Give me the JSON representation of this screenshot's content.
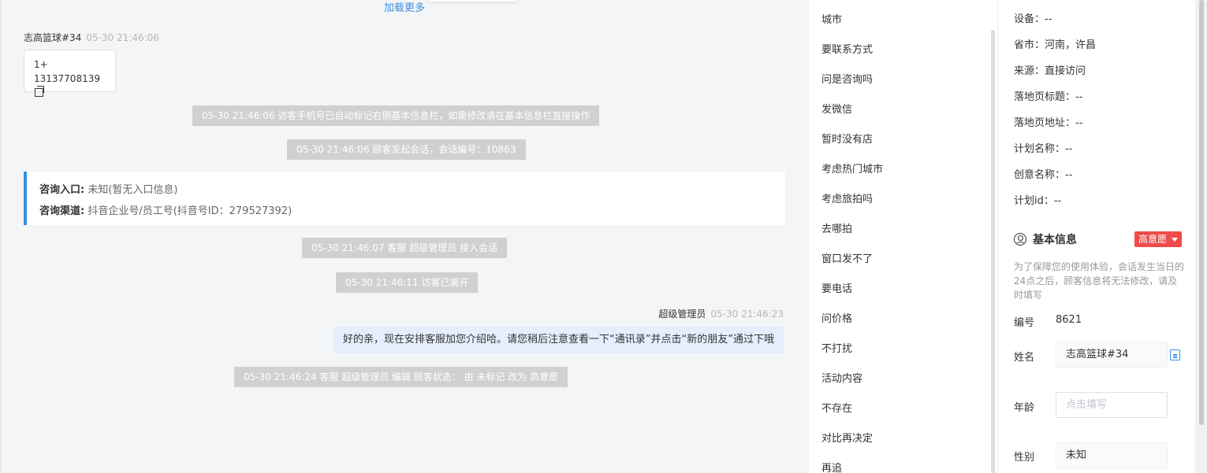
{
  "chat": {
    "load_more": "加载更多",
    "visitor": {
      "name": "志高篮球#34",
      "time": "05-30 21:46:06",
      "msg_line1": "1+",
      "msg_line2": "13137708139"
    },
    "system_messages": [
      "05-30 21:46:06 访客手机号已自动标记右侧基本信息栏，如需修改请在基本信息栏直接操作",
      "05-30 21:46:06 顾客发起会话，会话编号：10863",
      "05-30 21:46:07 客服 超级管理员 接入会话",
      "05-30 21:46:11 访客已离开",
      "05-30 21:46:24 客服 超级管理员 编辑 顾客状态： 由 未标记 改为 高意愿"
    ],
    "entry": {
      "entry_label": "咨询入口:",
      "entry_value": "未知(暂无入口信息)",
      "channel_label": "咨询渠道:",
      "channel_value": "抖音企业号/员工号(抖音号ID：279527392)"
    },
    "agent": {
      "name": "超级管理员",
      "time": "05-30 21:46:23",
      "message": "好的亲，现在安排客服加您介绍哈。请您稍后注意查看一下“通讯录”并点击“新的朋友”通过下哦"
    }
  },
  "quick_replies": [
    "城市",
    "要联系方式",
    "问是咨询吗",
    "发微信",
    "暂时没有店",
    "考虑热门城市",
    "考虑旅拍吗",
    "去哪拍",
    "窗口发不了",
    "要电话",
    "问价格",
    "不打扰",
    "活动内容",
    "不存在",
    "对比再决定",
    "再追"
  ],
  "info": {
    "rows": [
      "设备：--",
      "省市：河南，许昌",
      "来源：直接访问",
      "落地页标题：--",
      "落地页地址：--",
      "计划名称：--",
      "创意名称：--",
      "计划id：--"
    ],
    "section_title": "基本信息",
    "intent": "高意愿",
    "note": "为了保障您的使用体验，会话发生当日的24点之后，顾客信息将无法修改，请及时填写",
    "id_label": "编号",
    "id_value": "8621",
    "name_label": "姓名",
    "name_value": "志高篮球#34",
    "age_label": "年龄",
    "age_placeholder": "点击填写",
    "gender_label": "性别",
    "gender_value": "未知"
  },
  "colors": {
    "accent": "#3a8ee6",
    "intent_badge": "#f04b4b",
    "system_msg_bg": "#cfd0d2",
    "agent_bubble_bg": "#e4eefd"
  }
}
